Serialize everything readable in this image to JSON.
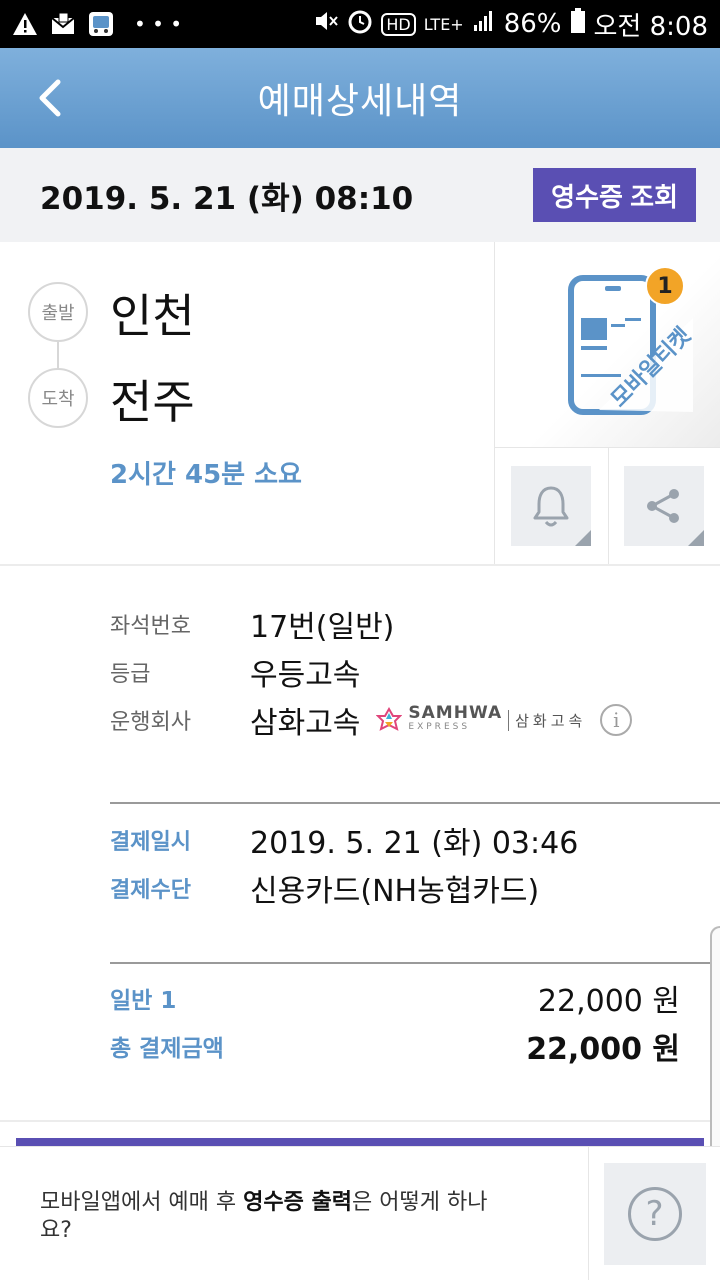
{
  "status_bar": {
    "battery": "86%",
    "time": "오전 8:08",
    "network": "LTE+",
    "hd": "HD"
  },
  "app_bar": {
    "title": "예매상세내역"
  },
  "date_row": {
    "departure_datetime": "2019. 5. 21 (화) 08:10",
    "receipt_button": "영수증 조회"
  },
  "route": {
    "departure_label": "출발",
    "departure_city": "인천",
    "arrival_label": "도착",
    "arrival_city": "전주",
    "duration": "2시간 45분 소요"
  },
  "mobile_ticket": {
    "label": "모바일티켓",
    "count": "1"
  },
  "details": {
    "seat_label": "좌석번호",
    "seat_value": "17번(일반)",
    "grade_label": "등급",
    "grade_value": "우등고속",
    "company_label": "운행회사",
    "company_value": "삼화고속",
    "logo_text": "SAMHWA",
    "logo_sub": "EXPRESS",
    "logo_ko": "삼화고속"
  },
  "payment": {
    "date_label": "결제일시",
    "date_value": "2019. 5. 21 (화) 03:46",
    "method_label": "결제수단",
    "method_value": "신용카드(NH농협카드)"
  },
  "price": {
    "item_label": "일반 1",
    "item_value": "22,000 원",
    "total_label": "총 결제금액",
    "total_value": "22,000 원"
  },
  "help": {
    "text_before": "모바일앱에서 예매 후 ",
    "text_bold": "영수증 출력",
    "text_after": "은 어떻게 하나요?",
    "icon_glyph": "?"
  },
  "colors": {
    "primary_blue": "#5b93c8",
    "purple": "#5a4fb3",
    "badge_orange": "#f2a427"
  }
}
